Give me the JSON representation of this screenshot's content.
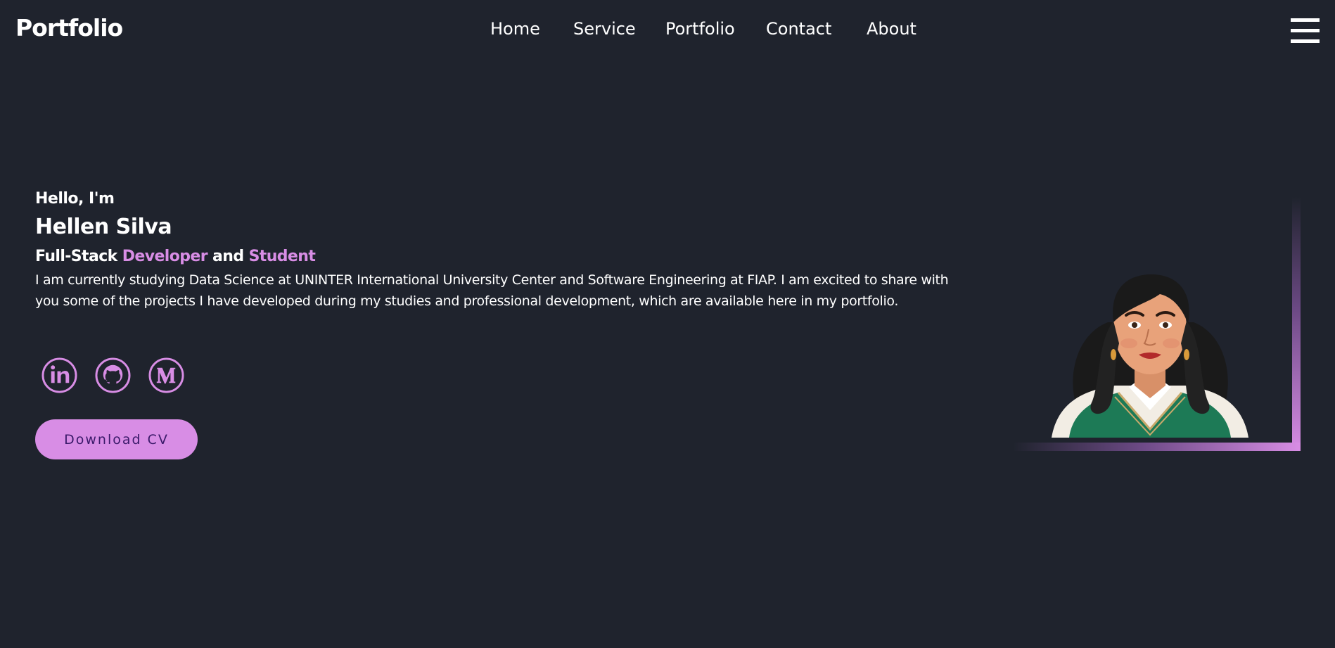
{
  "header": {
    "logo": "Portfolio",
    "nav": [
      "Home",
      "Service",
      "Portfolio",
      "Contact",
      "About"
    ],
    "menu_icon": "hamburger-menu-icon"
  },
  "hero": {
    "greeting": "Hello, I'm",
    "name": "Hellen Silva",
    "role": {
      "part1": "Full-Stack",
      "highlight1": "Developer",
      "part2": "and",
      "highlight2": "Student"
    },
    "bio": "I am currently studying Data Science at UNINTER International University Center and Software Engineering at FIAP. I am excited to share with you some of the projects I have developed during my studies and professional development, which are available here in my portfolio.",
    "social": [
      {
        "name": "LinkedIn",
        "icon": "linkedin-icon"
      },
      {
        "name": "GitHub",
        "icon": "github-icon"
      },
      {
        "name": "Medium",
        "icon": "medium-icon"
      }
    ],
    "cv_button": "Download CV",
    "portrait": "illustrated-portrait"
  },
  "colors": {
    "background": "#1f232d",
    "accent": "#d88de5",
    "text": "#ffffff",
    "button_text": "#3b1a6a"
  }
}
